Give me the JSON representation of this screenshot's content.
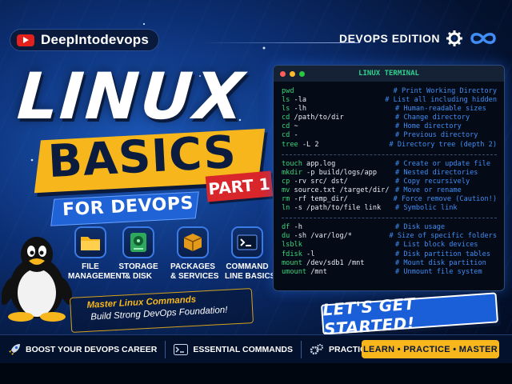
{
  "channel": {
    "name": "DeepIntodevops",
    "icon": "youtube-icon",
    "brand_color": "#e3211c"
  },
  "edition": {
    "label": "DEVOPS EDITION",
    "icons": [
      "gear-icon",
      "infinity-icon"
    ]
  },
  "title": {
    "line1": "LINUX",
    "line2": "BASICS",
    "part": "PART 1",
    "line3": "FOR DEVOPS"
  },
  "features": [
    {
      "label_line1": "FILE",
      "label_line2": "MANAGEMENT",
      "icon": "folder-icon"
    },
    {
      "label_line1": "STORAGE",
      "label_line2": "& DISK",
      "icon": "hard-disk-icon"
    },
    {
      "label_line1": "PACKAGES",
      "label_line2": "& SERVICES",
      "icon": "package-icon"
    },
    {
      "label_line1": "COMMAND",
      "label_line2": "LINE BASICS",
      "icon": "terminal-icon"
    }
  ],
  "tagline": {
    "line1": "Master Linux Commands",
    "line2": "Build Strong DevOps Foundation!"
  },
  "terminal": {
    "title": "LINUX TERMINAL",
    "groups": [
      [
        {
          "kw": "pwd",
          "args": "",
          "comment": "# Print Working Directory"
        },
        {
          "kw": "ls",
          "args": " -la",
          "comment": "# List all including hidden"
        },
        {
          "kw": "ls",
          "args": " -lh",
          "comment": "# Human-readable sizes"
        },
        {
          "kw": "cd",
          "args": " /path/to/dir",
          "comment": "# Change directory"
        },
        {
          "kw": "cd",
          "args": " ~",
          "comment": "# Home directory"
        },
        {
          "kw": "cd",
          "args": " -",
          "comment": "# Previous directory"
        },
        {
          "kw": "tree",
          "args": " -L 2",
          "comment": "# Directory tree (depth 2)"
        }
      ],
      [
        {
          "kw": "touch",
          "args": " app.log",
          "comment": "# Create or update file"
        },
        {
          "kw": "mkdir",
          "args": " -p build/logs/app",
          "comment": "# Nested directories"
        },
        {
          "kw": "cp",
          "args": " -rv src/ dst/",
          "comment": "# Copy recursively"
        },
        {
          "kw": "mv",
          "args": " source.txt /target/dir/",
          "comment": "# Move or rename"
        },
        {
          "kw": "rm",
          "args": " -rf temp_dir/",
          "comment": "# Force remove (Caution!)"
        },
        {
          "kw": "ln",
          "args": " -s /path/to/file link",
          "comment": "# Symbolic link"
        }
      ],
      [
        {
          "kw": "df",
          "args": " -h",
          "comment": "# Disk usage"
        },
        {
          "kw": "du",
          "args": " -sh /var/log/*",
          "comment": "# Size of specific folders"
        },
        {
          "kw": "lsblk",
          "args": "",
          "comment": "# List block devices"
        },
        {
          "kw": "fdisk",
          "args": " -l",
          "comment": "# Disk partition tables"
        },
        {
          "kw": "mount",
          "args": " /dev/sdb1 /mnt",
          "comment": "# Mount disk partition"
        },
        {
          "kw": "umount",
          "args": " /mnt",
          "comment": "# Unmount file system"
        }
      ]
    ],
    "dot_colors": [
      "#ff5f57",
      "#febc2e",
      "#28c840"
    ]
  },
  "cta": {
    "label": "LET'S GET STARTED!"
  },
  "bottom_bar": {
    "items": [
      {
        "label": "BOOST YOUR DEVOPS CAREER",
        "icon": "rocket-icon"
      },
      {
        "label": "ESSENTIAL COMMANDS",
        "icon": "terminal-icon"
      },
      {
        "label": "PRACTICAL EXAMPLES",
        "icon": "gears-icon"
      }
    ],
    "highlight": "LEARN • PRACTICE • MASTER"
  },
  "colors": {
    "accent_yellow": "#f6b61c",
    "accent_red": "#d9262a",
    "accent_blue": "#1f63d6",
    "command_green": "#37d67a",
    "comment_blue": "#3f8df5"
  }
}
